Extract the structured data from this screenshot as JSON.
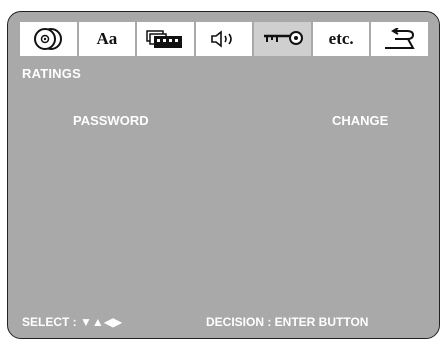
{
  "tabs": [
    {
      "label": "",
      "icon": "disc-icon"
    },
    {
      "label": "Aa",
      "icon": "language-icon"
    },
    {
      "label": "",
      "icon": "picture-icon"
    },
    {
      "label": "",
      "icon": "speaker-icon"
    },
    {
      "label": "",
      "icon": "key-icon",
      "active": true
    },
    {
      "label": "etc.",
      "icon": "etc-icon"
    },
    {
      "label": "",
      "icon": "return-icon"
    }
  ],
  "menu": {
    "title": "RATINGS",
    "option_label": "PASSWORD",
    "option_value": "CHANGE"
  },
  "footer": {
    "select_label": "SELECT :",
    "select_arrows": "▼▲◀▶",
    "decision_label": "DECISION : ENTER  BUTTON"
  },
  "colors": {
    "panel": "#a9a9a9",
    "tab": "#ffffff",
    "active_tab": "#cfcfcf",
    "text": "#ffffff"
  }
}
